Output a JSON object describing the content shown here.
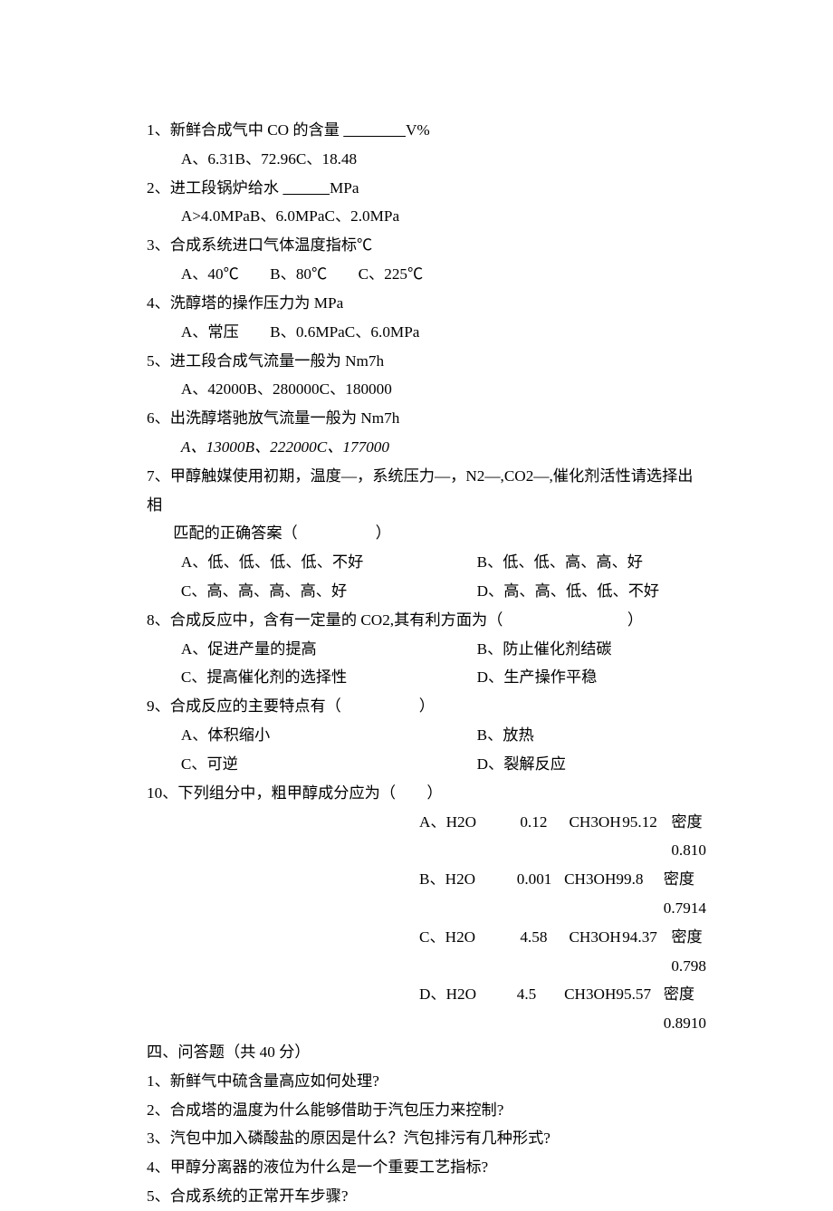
{
  "q1": {
    "label": "1、新鲜合成气中 CO 的含量 ",
    "blank": "　　　　",
    "unit": "V%",
    "opts": "A、6.31B、72.96C、18.48"
  },
  "q2": {
    "label": "2、进工段锅炉给水 ",
    "blank": "　　　",
    "unit": "MPa",
    "opts": "A>4.0MPaB、6.0MPaC、2.0MPa"
  },
  "q3": {
    "label": "3、合成系统进口气体温度指标℃",
    "opts": "A、40℃　　B、80℃　　C、225℃"
  },
  "q4": {
    "label": "4、洗醇塔的操作压力为 MPa",
    "opts": "A、常压　　B、0.6MPaC、6.0MPa"
  },
  "q5": {
    "label": "5、进工段合成气流量一般为 Nm7h",
    "opts": "A、42000B、280000C、180000"
  },
  "q6": {
    "label": "6、出洗醇塔驰放气流量一般为 Nm7h",
    "opts": "A、13000B、222000C、177000"
  },
  "q7": {
    "line1": "7、甲醇触媒使用初期，温度—，系统压力—，N2—,CO2—,催化剂活性请选择出相",
    "line2": "匹配的正确答案（　　　　　）",
    "a": "A、低、低、低、低、不好",
    "b": "B、低、低、高、高、好",
    "c": "C、高、高、高、高、好",
    "d": "D、高、高、低、低、不好"
  },
  "q8": {
    "label": "8、合成反应中，含有一定量的 CO2,其有利方面为（　　　　　　　　）",
    "a": "A、促进产量的提高",
    "b": "B、防止催化剂结碳",
    "c": "C、提高催化剂的选择性",
    "d": "D、生产操作平稳"
  },
  "q9": {
    "label": "9、合成反应的主要特点有（　　　　　）",
    "a": "A、体积缩小",
    "b": "B、放热",
    "c": "C、可逆",
    "d": "D、裂解反应"
  },
  "q10": {
    "label": "10、下列组分中，粗甲醇成分应为（　　）",
    "rows": [
      {
        "c1": "A、H2O",
        "c2": "0.12",
        "c3": "CH3OH",
        "c4": "95.12",
        "c5": "密度 0.810"
      },
      {
        "c1": "B、H2O",
        "c2": "0.001",
        "c3": "CH3OH",
        "c4": "99.8",
        "c5": "密度 0.7914"
      },
      {
        "c1": "C、H2O",
        "c2": "4.58",
        "c3": "CH3OH",
        "c4": "94.37",
        "c5": "密度 0.798"
      },
      {
        "c1": "D、H2O",
        "c2": "4.5",
        "c3": "CH3OH",
        "c4": "95.57",
        "c5": "密度 0.8910"
      }
    ]
  },
  "sec4": {
    "title": "四、问答题（共 40 分）",
    "s1": "1、新鲜气中硫含量高应如何处理?",
    "s2": "2、合成塔的温度为什么能够借助于汽包压力来控制?",
    "s3": "3、汽包中加入磷酸盐的原因是什么？汽包排污有几种形式?",
    "s4": "4、甲醇分离器的液位为什么是一个重要工艺指标?",
    "s5": "5、合成系统的正常开车步骤?"
  }
}
